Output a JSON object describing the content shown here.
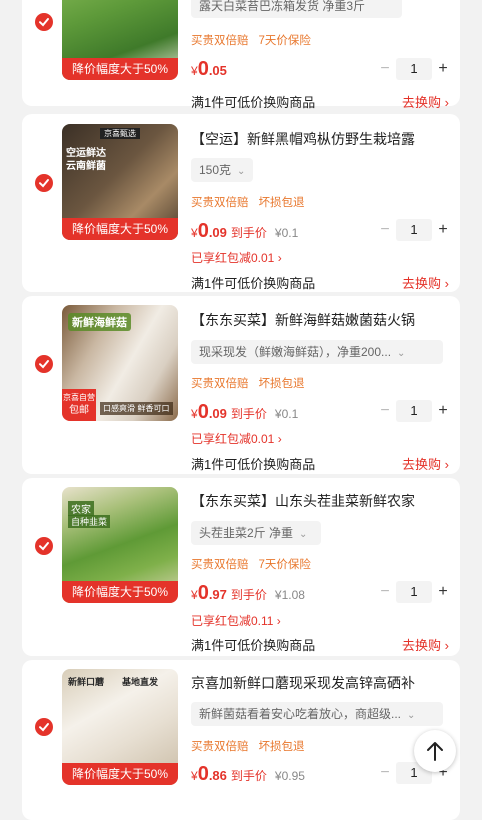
{
  "items": [
    {
      "spec": "露天白菜苔巴冻箱发货 净重3斤",
      "tags": [
        "买贵双倍赔",
        "7天价保险"
      ],
      "price_int": "0",
      "price_dec": ".05",
      "banner": "降价幅度大于50%",
      "quantity": "1",
      "swap_text": "满1件可低价换购商品",
      "swap_link": "去换购 ›"
    },
    {
      "title": "【空运】新鲜黑帽鸡枞仿野生栽培露",
      "spec": "150克",
      "tags": [
        "买贵双倍赔",
        "坏损包退"
      ],
      "price_int": "0",
      "price_dec": ".09",
      "price_tag": "到手价",
      "orig_price": "¥0.1",
      "promo": "已享红包减0.01 ›",
      "banner": "降价幅度大于50%",
      "quantity": "1",
      "swap_text": "满1件可低价换购商品",
      "swap_link": "去换购 ›",
      "thumb_top": "京喜甄选",
      "thumb_line1": "空运鲜达",
      "thumb_line2": "云南鲜菌"
    },
    {
      "title": "【东东买菜】新鲜海鲜菇嫩菌菇火锅",
      "spec": "现采现发（鲜嫩海鲜菇），净重200...",
      "tags": [
        "买贵双倍赔",
        "坏损包退"
      ],
      "price_int": "0",
      "price_dec": ".09",
      "price_tag": "到手价",
      "orig_price": "¥0.1",
      "promo": "已享红包减0.01 ›",
      "quantity": "1",
      "swap_text": "满1件可低价换购商品",
      "swap_link": "去换购 ›",
      "thumb_label": "新鲜海鲜菇",
      "thumb_badge1": "京喜自营",
      "thumb_badge2": "包邮",
      "thumb_foot": "口感爽滑 鲜香可口"
    },
    {
      "title": "【东东买菜】山东头茬韭菜新鲜农家",
      "spec": "头茬韭菜2斤 净重",
      "tags": [
        "买贵双倍赔",
        "7天价保险"
      ],
      "price_int": "0",
      "price_dec": ".97",
      "price_tag": "到手价",
      "orig_price": "¥1.08",
      "promo": "已享红包减0.11 ›",
      "banner": "降价幅度大于50%",
      "quantity": "1",
      "swap_text": "满1件可低价换购商品",
      "swap_link": "去换购 ›",
      "thumb_label1": "农家",
      "thumb_label2": "自种韭菜"
    },
    {
      "title": "京喜加新鲜口蘑现采现发高锌高硒补",
      "spec": "新鲜菌菇看着安心吃着放心，商超级...",
      "tags": [
        "买贵双倍赔",
        "坏损包退"
      ],
      "price_int": "0",
      "price_dec": ".86",
      "price_tag": "到手价",
      "orig_price": "¥0.95",
      "banner": "降价幅度大于50%",
      "quantity": "1",
      "thumb_label1": "新鲜口蘑",
      "thumb_label2": "基地直发"
    }
  ],
  "colors": {
    "accent": "#e4332a",
    "tag_orange": "#e8772d"
  }
}
